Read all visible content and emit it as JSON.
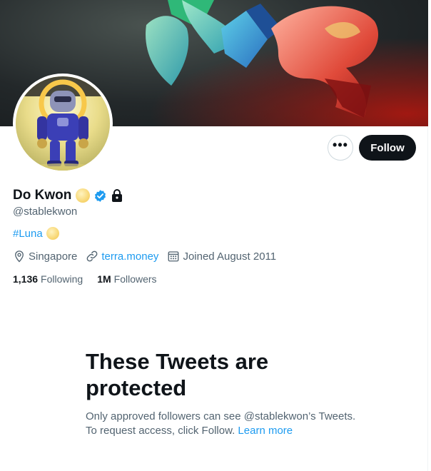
{
  "profile": {
    "name": "Do Kwon",
    "handle": "@stablekwon",
    "bio_hashtag": "#Luna",
    "location": "Singapore",
    "website": "terra.money",
    "joined": "Joined August 2011"
  },
  "stats": {
    "following_count": "1,136",
    "following_label": "Following",
    "followers_count": "1M",
    "followers_label": "Followers"
  },
  "actions": {
    "more_label": "•••",
    "follow_label": "Follow"
  },
  "protected": {
    "title": "These Tweets are protected",
    "desc_prefix": "Only approved followers can see @stablekwon’s Tweets. To request access, click Follow. ",
    "learn_more": "Learn more"
  },
  "icons": {
    "badge": "verified-badge-icon",
    "lock": "lock-icon",
    "location": "location-pin-icon",
    "link": "link-icon",
    "calendar": "calendar-icon"
  },
  "colors": {
    "accent": "#1d9bf0",
    "text": "#0f1419",
    "secondary": "#536471",
    "follow_button": "#0f1419"
  }
}
